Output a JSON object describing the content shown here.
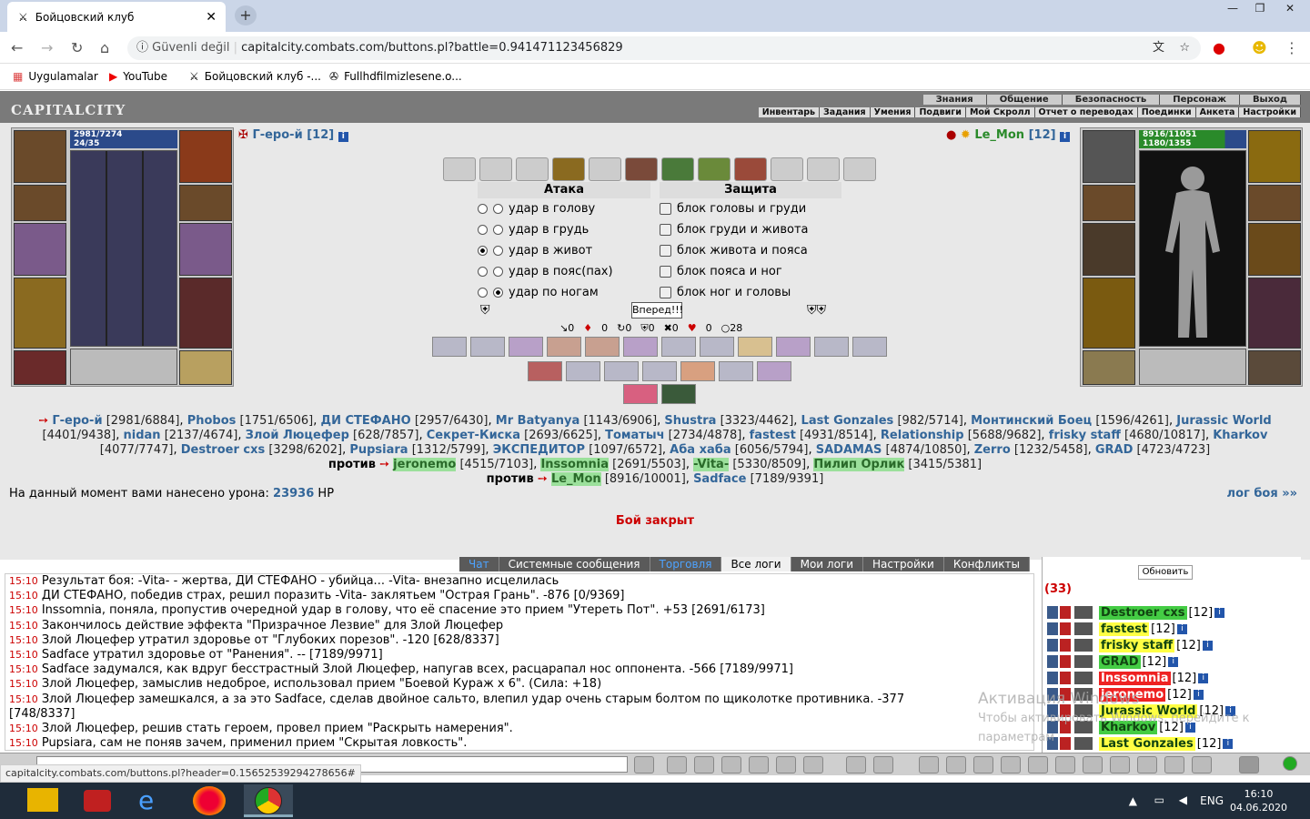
{
  "browser": {
    "tab_title": "Бойцовский клуб",
    "insecure_label": "Güvenli değil",
    "url": "capitalcity.combats.com/buttons.pl?battle=0.941471123456829",
    "bookmarks": [
      "Uygulamalar",
      "YouTube",
      "Бойцовский клуб -...",
      "Fullhdfilmizlesene.o..."
    ]
  },
  "game": {
    "logo": "CAPITALCITY",
    "top_menu": [
      "Знания",
      "Общение",
      "Безопасность",
      "Персонаж",
      "Выход"
    ],
    "sub_menu": [
      "Инвентарь",
      "Задания",
      "Умения",
      "Подвиги",
      "Мой Скролл",
      "Отчет о переводах",
      "Поединки",
      "Анкета",
      "Настройки"
    ],
    "left_char": {
      "name": "Г-еро-й",
      "level": "[12]",
      "hp": "2981/7274",
      "mana": "24/35"
    },
    "right_char": {
      "name": "Le_Mon",
      "level": "[12]",
      "hp": "8916/11051",
      "mana": "1180/1355"
    },
    "attack": {
      "header": "Атака",
      "options": [
        "удар в голову",
        "удар в грудь",
        "удар в живот",
        "удар в пояс(пах)",
        "удар по ногам"
      ],
      "selected": 2
    },
    "defense": {
      "header": "Защита",
      "options": [
        "блок головы и груди",
        "блок груди и живота",
        "блок живота и пояса",
        "блок пояса и ног",
        "блок ног и головы"
      ]
    },
    "forward_button": "Вперед!!!",
    "stats": [
      "0",
      "0",
      "0",
      "0",
      "0",
      "0",
      "28"
    ],
    "team1": [
      {
        "n": "Г-еро-й",
        "h": "[2981/6884]"
      },
      {
        "n": "Phobos",
        "h": "[1751/6506]"
      },
      {
        "n": "ДИ СТЕФАНО",
        "h": "[2957/6430]"
      },
      {
        "n": "Mr Batyanya",
        "h": "[1143/6906]"
      },
      {
        "n": "Shustra",
        "h": "[3323/4462]"
      },
      {
        "n": "Last Gonzales",
        "h": "[982/5714]"
      },
      {
        "n": "Монтинский Боец",
        "h": "[1596/4261]"
      },
      {
        "n": "Jurassic World",
        "h": "[4401/9438]"
      },
      {
        "n": "nidan",
        "h": "[2137/4674]"
      },
      {
        "n": "Злой Люцефер",
        "h": "[628/7857]"
      },
      {
        "n": "Секрет-Киска",
        "h": "[2693/6625]"
      },
      {
        "n": "Томатыч",
        "h": "[2734/4878]"
      },
      {
        "n": "fastest",
        "h": "[4931/8514]"
      },
      {
        "n": "Relationship",
        "h": "[5688/9682]"
      },
      {
        "n": "frisky staff",
        "h": "[4680/10817]"
      },
      {
        "n": "Kharkov",
        "h": "[4077/7747]"
      },
      {
        "n": "Destroer cxs",
        "h": "[3298/6202]"
      },
      {
        "n": "Pupsiara",
        "h": "[1312/5799]"
      },
      {
        "n": "ЭКСПЕДИТОР",
        "h": "[1097/6572]"
      },
      {
        "n": "Аба хаба",
        "h": "[6056/5794]"
      },
      {
        "n": "SADAMAS",
        "h": "[4874/10850]"
      },
      {
        "n": "Zerro",
        "h": "[1232/5458]"
      },
      {
        "n": "GRAD",
        "h": "[4723/4723]"
      }
    ],
    "vs1_label": "против",
    "team2": [
      {
        "n": "jeronemo",
        "h": "[4515/7103]"
      },
      {
        "n": "Inssomnia",
        "h": "[2691/5503]"
      },
      {
        "n": "-Vita-",
        "h": "[5330/8509]"
      },
      {
        "n": "Пилип Орлик",
        "h": "[3415/5381]"
      }
    ],
    "vs2_label": "против",
    "team3": [
      {
        "n": "Le_Mon",
        "h": "[8916/10001]"
      },
      {
        "n": "Sadface",
        "h": "[7189/9391]"
      }
    ],
    "damage_text": "На данный момент вами нанесено урона:",
    "damage_value": "23936",
    "damage_unit": "HP",
    "log_link": "лог боя »»",
    "battle_closed": "Бой закрыт"
  },
  "chat": {
    "tabs": [
      "Чат",
      "Системные сообщения",
      "Торговля",
      "Все логи",
      "Мои логи",
      "Настройки",
      "Конфликты"
    ],
    "lines": [
      "Результат боя: -Vita- - жертва, ДИ СТЕФАНО - убийца... -Vita- внезапно исцелилась",
      "ДИ СТЕФАНО, победив страх, решил поразить -Vita- заклятьем \"Острая Грань\". -876 [0/9369]",
      "Inssomnia, поняла, пропустив очередной удар в голову, что её спасение это прием \"Утереть Пот\". +53 [2691/6173]",
      "Закончилось действие эффекта \"Призрачное Лезвие\" для Злой Люцефер",
      "Злой Люцефер утратил здоровье от \"Глубоких порезов\". -120 [628/8337]",
      "Sadface утратил здоровье от \"Ранения\". -- [7189/9971]",
      "Sadface задумался, как вдруг бесстрастный Злой Люцефер, напугав всех, расцарапал нос оппонента. -566 [7189/9971]",
      "Злой Люцефер, замыслив недоброе, использовал прием \"Боевой Кураж х 6\". (Сила: +18)",
      "Злой Люцефер замешкался, а за это Sadface, сделав двойное сальто, влепил удар очень старым болтом по щиколотке противника. -377",
      "[748/8337]",
      "Злой Люцефер, решив стать героем, провел прием \"Раскрыть намерения\".",
      "Pupsiara, сам не поняв зачем, применил прием \"Скрытая ловкость\"."
    ],
    "times": [
      "15:10",
      "15:10",
      "15:10",
      "15:10",
      "15:10",
      "15:10",
      "15:10",
      "15:10",
      "15:10",
      "",
      "15:10",
      "15:10"
    ]
  },
  "online": {
    "refresh": "Обновить",
    "count": "(33)",
    "users": [
      {
        "n": "Destroer cxs",
        "l": "[12]",
        "c": "g"
      },
      {
        "n": "fastest",
        "l": "[12]",
        "c": "y"
      },
      {
        "n": "frisky staff",
        "l": "[12]",
        "c": "y"
      },
      {
        "n": "GRAD",
        "l": "[12]",
        "c": "g"
      },
      {
        "n": "Inssomnia",
        "l": "[12]",
        "c": "r"
      },
      {
        "n": "jeronemo",
        "l": "[12]",
        "c": "r"
      },
      {
        "n": "Jurassic World",
        "l": "[12]",
        "c": "y"
      },
      {
        "n": "Kharkov",
        "l": "[12]",
        "c": "g"
      },
      {
        "n": "Last Gonzales",
        "l": "[12]",
        "c": "y"
      }
    ]
  },
  "watermark": {
    "title": "Активация Windows",
    "sub": "Чтобы активировать Windows, перейдите к параметрам"
  },
  "status_url": "capitalcity.combats.com/buttons.pl?header=0.15652539294278656#",
  "taskbar": {
    "lang": "ENG",
    "time": "16:10",
    "date": "04.06.2020"
  }
}
